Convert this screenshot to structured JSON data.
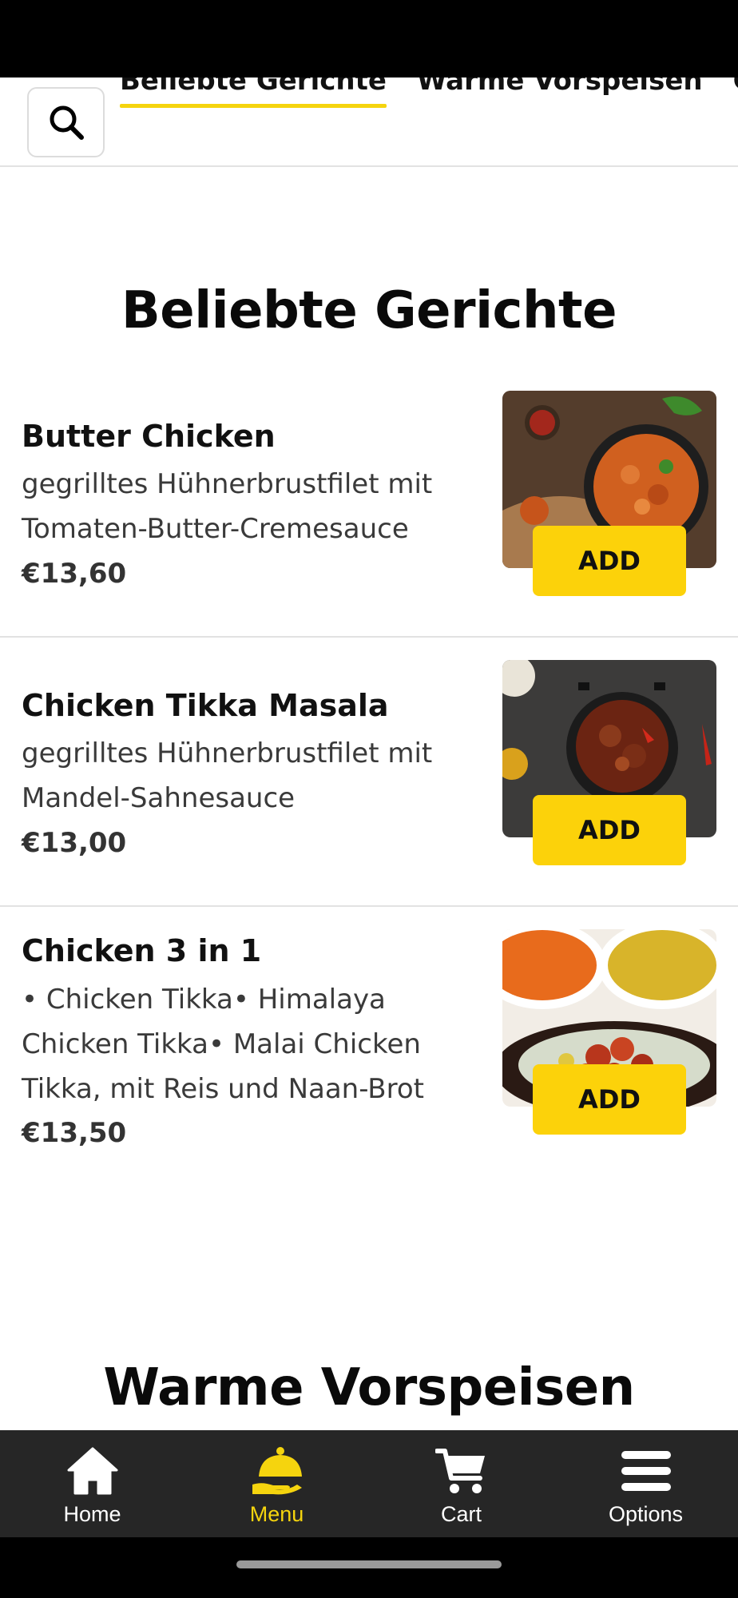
{
  "categories": {
    "tabs": [
      "Beliebte Gerichte",
      "Warme Vorspeisen",
      "Gr"
    ],
    "active_index": 0
  },
  "sections": [
    {
      "title": "Beliebte Gerichte",
      "items": [
        {
          "name": "Butter Chicken",
          "description": "gegrilltes Hühnerbrustfilet mit Tomaten-Butter-Cremesauce",
          "price": "€13,60",
          "add_label": "ADD"
        },
        {
          "name": "Chicken Tikka Masala",
          "description": "gegrilltes Hühnerbrustfilet mit Mandel-Sahnesauce",
          "price": "€13,00",
          "add_label": "ADD"
        },
        {
          "name": "Chicken 3 in 1",
          "description": "• Chicken Tikka• Himalaya Chicken Tikka• Malai Chicken Tikka, mit Reis und Naan-Brot",
          "price": "€13,50",
          "add_label": "ADD"
        }
      ]
    },
    {
      "title": "Warme Vorspeisen"
    }
  ],
  "bottom_nav": [
    {
      "label": "Home",
      "icon": "home-icon",
      "active": false
    },
    {
      "label": "Menu",
      "icon": "cloche-icon",
      "active": true
    },
    {
      "label": "Cart",
      "icon": "cart-icon",
      "active": false
    },
    {
      "label": "Options",
      "icon": "hamburger-icon",
      "active": false
    }
  ],
  "colors": {
    "accent": "#fcd20a",
    "nav_bg": "#262626",
    "nav_active": "#f5d40e"
  }
}
